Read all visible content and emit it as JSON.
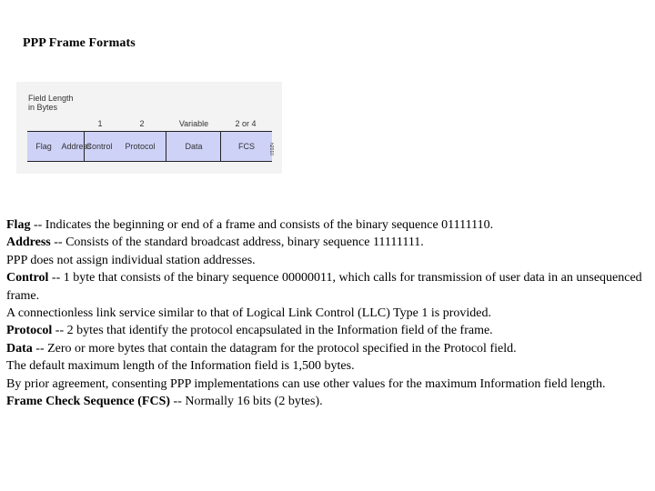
{
  "page": {
    "title": "PPP Frame Formats"
  },
  "figure": {
    "field_length_label_line1": "Field Length",
    "field_length_label_line2": "in Bytes",
    "lengths": [
      "1",
      "2",
      "Variable",
      "2 or 4"
    ],
    "fields": [
      "Flag",
      "Address",
      "Control",
      "Protocol",
      "Data",
      "FCS"
    ],
    "figure_id": "h2010",
    "fill_color": "#ced2f7"
  },
  "description": [
    {
      "term": "Flag",
      "text": " -- Indicates the beginning or end of a frame and consists of the binary sequence 01111110."
    },
    {
      "term": "Address",
      "text": " -- Consists of the standard broadcast address, binary sequence 11111111."
    },
    {
      "term": "",
      "text": "PPP does not assign individual station addresses."
    },
    {
      "term": "Control",
      "text": " -- 1 byte that consists of the binary sequence 00000011, which calls for transmission of user data in an unsequenced frame."
    },
    {
      "term": "",
      "text": "A connectionless link service similar to that of Logical Link Control (LLC) Type 1 is provided."
    },
    {
      "term": "Protocol",
      "text": " -- 2 bytes that identify the protocol encapsulated in the Information field of the frame."
    },
    {
      "term": "Data",
      "text": " -- Zero or more bytes that contain the datagram for the protocol specified in the Protocol field."
    },
    {
      "term": "",
      "text": "The default maximum length of the Information field is 1,500 bytes."
    },
    {
      "term": "",
      "text": "By prior agreement, consenting PPP implementations can use other values for the maximum Information field length."
    },
    {
      "term": "Frame Check Sequence (FCS)",
      "text": " -- Normally 16 bits (2 bytes)."
    }
  ]
}
